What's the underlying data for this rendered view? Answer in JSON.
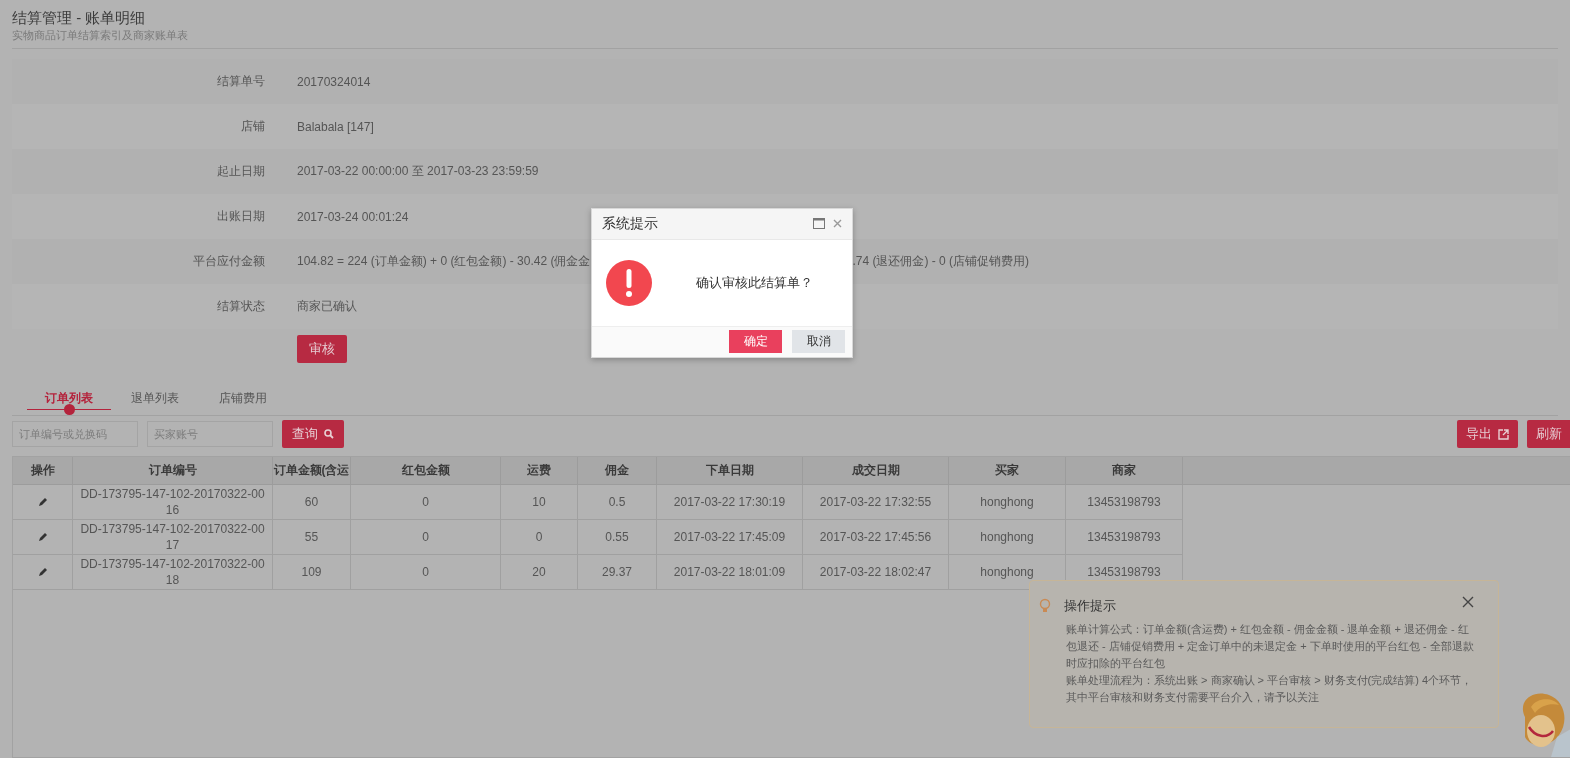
{
  "header": {
    "title": "结算管理 - 账单明细",
    "subtitle": "实物商品订单结算索引及商家账单表"
  },
  "fields": [
    {
      "kind": "plain",
      "label": "结算单号",
      "value": "20170324014"
    },
    {
      "kind": "plain",
      "label": "店铺",
      "value": "Balabala [147]"
    },
    {
      "kind": "plain",
      "label": "起止日期",
      "value": "2017-03-22 00:00:00 至 2017-03-23 23:59:59"
    },
    {
      "kind": "plain",
      "label": "出账日期",
      "value": "2017-03-24 00:01:24"
    },
    {
      "kind": "split",
      "label": "平台应付金额",
      "value": "104.82 = 224 (订单金额) + 0 (红包金额) - 30.42 (佣金金",
      "value_after": ".74 (退还佣金) - 0 (店铺促销费用)"
    },
    {
      "kind": "plain",
      "label": "结算状态",
      "value": "商家已确认"
    }
  ],
  "audit_button": "审核",
  "tabs": [
    {
      "label": "订单列表",
      "selected": true
    },
    {
      "label": "退单列表",
      "selected": false
    },
    {
      "label": "店铺费用",
      "selected": false
    }
  ],
  "search": {
    "fields": [
      {
        "placeholder": "订单编号或兑换码"
      },
      {
        "placeholder": "买家账号"
      }
    ],
    "button": "查询"
  },
  "toolbar_buttons": [
    {
      "kind": "export",
      "label": "导出"
    },
    {
      "kind": "refresh",
      "label": "刷新"
    }
  ],
  "table": {
    "columns": [
      "操作",
      "订单编号",
      "订单金额(含运",
      "红包金额",
      "运费",
      "佣金",
      "下单日期",
      "成交日期",
      "买家",
      "商家"
    ],
    "rows": [
      [
        "",
        "DD-173795-147-102-20170322-0016",
        "60",
        "0",
        "10",
        "0.5",
        "2017-03-22 17:30:19",
        "2017-03-22 17:32:55",
        "honghong",
        "13453198793"
      ],
      [
        "",
        "DD-173795-147-102-20170322-0017",
        "55",
        "0",
        "0",
        "0.55",
        "2017-03-22 17:45:09",
        "2017-03-22 17:45:56",
        "honghong",
        "13453198793"
      ],
      [
        "",
        "DD-173795-147-102-20170322-0018",
        "109",
        "0",
        "20",
        "29.37",
        "2017-03-22 18:01:09",
        "2017-03-22 18:02:47",
        "honghong",
        "13453198793"
      ]
    ]
  },
  "dialog": {
    "title": "系统提示",
    "message": "确认审核此结算单？",
    "buttons": [
      {
        "kind": "primary",
        "label": "确定"
      },
      {
        "kind": "secondary",
        "label": "取消"
      }
    ]
  },
  "tips": {
    "title": "操作提示",
    "paragraphs": [
      "账单计算公式：订单金额(含运费) + 红包金额 - 佣金金额 - 退单金额 + 退还佣金 - 红包退还 - 店铺促销费用 + 定金订单中的未退定金 + 下单时使用的平台红包 - 全部退款时应扣除的平台红包",
      "账单处理流程为：系统出账 > 商家确认 > 平台审核 > 财务支付(完成结算) 4个环节，其中平台审核和财务支付需要平台介入，请予以关注"
    ]
  }
}
